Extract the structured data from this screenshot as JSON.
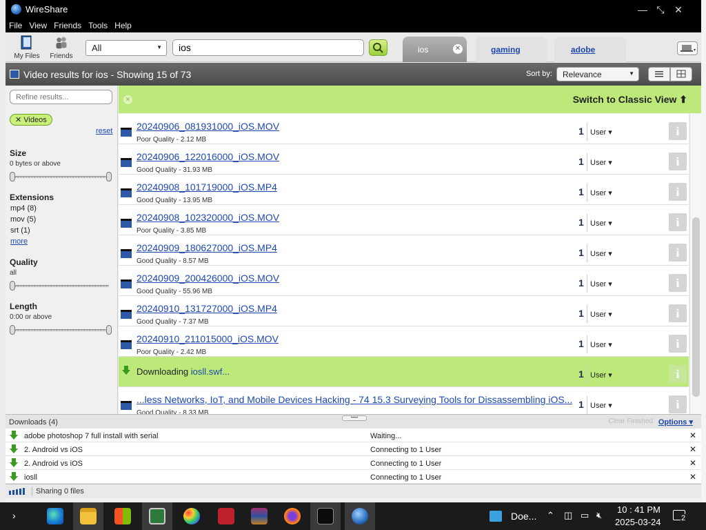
{
  "window": {
    "title": "WireShare"
  },
  "menu": [
    "File",
    "View",
    "Friends",
    "Tools",
    "Help"
  ],
  "toolbar": {
    "my_files": "My Files",
    "friends": "Friends",
    "type_select": "All",
    "search_value": "ios"
  },
  "tabs": [
    {
      "label": "ios",
      "active": true
    },
    {
      "label": "gaming",
      "active": false
    },
    {
      "label": "adobe",
      "active": false
    }
  ],
  "results_header": {
    "title": "Video results for ios - Showing 15 of 73",
    "sort_label": "Sort by:",
    "sort_value": "Relevance"
  },
  "filters": {
    "refine_placeholder": "Refine results...",
    "active_filter": "Videos",
    "reset": "reset",
    "size": {
      "title": "Size",
      "value": "0 bytes or above"
    },
    "extensions": {
      "title": "Extensions",
      "items": [
        "mp4 (8)",
        "mov (5)",
        "srt (1)"
      ],
      "more": "more"
    },
    "quality": {
      "title": "Quality",
      "value": "all"
    },
    "length": {
      "title": "Length",
      "value": "0:00 or above"
    }
  },
  "switch_view": "Switch to Classic View",
  "results": [
    {
      "name": "20240906_081931000_iOS.MOV",
      "sub": "Poor Quality - 2.12 MB",
      "count": "1",
      "user": "User"
    },
    {
      "name": "20240906_122016000_iOS.MOV",
      "sub": "Good Quality - 31.93 MB",
      "count": "1",
      "user": "User"
    },
    {
      "name": "20240908_101719000_iOS.MP4",
      "sub": "Good Quality - 13.95 MB",
      "count": "1",
      "user": "User"
    },
    {
      "name": "20240908_102320000_iOS.MOV",
      "sub": "Poor Quality - 3.85 MB",
      "count": "1",
      "user": "User"
    },
    {
      "name": "20240909_180627000_iOS.MP4",
      "sub": "Good Quality - 8.57 MB",
      "count": "1",
      "user": "User"
    },
    {
      "name": "20240909_200426000_iOS.MOV",
      "sub": "Good Quality - 55.96 MB",
      "count": "1",
      "user": "User"
    },
    {
      "name": "20240910_131727000_iOS.MP4",
      "sub": "Good Quality - 7.37 MB",
      "count": "1",
      "user": "User"
    },
    {
      "name": "20240910_211015000_iOS.MOV",
      "sub": "Poor Quality - 2.42 MB",
      "count": "1",
      "user": "User"
    }
  ],
  "downloading_row": {
    "prefix": "Downloading",
    "file": "iosll.swf...",
    "count": "1",
    "user": "User"
  },
  "last_result": {
    "name": "...less Networks, IoT, and Mobile Devices Hacking - 74 15.3 Surveying Tools for Dissassembling iOS...",
    "sub": "Good Quality - 8.33 MB",
    "count": "1",
    "user": "User"
  },
  "downloads": {
    "title": "Downloads (4)",
    "clear": "Clear Finished",
    "options": "Options",
    "items": [
      {
        "name": "adobe photoshop 7 full install with serial",
        "status": "Waiting..."
      },
      {
        "name": "2. Android vs iOS",
        "status": "Connecting to 1 User"
      },
      {
        "name": "2. Android vs iOS",
        "status": "Connecting to 1 User"
      },
      {
        "name": "iosll",
        "status": "Connecting to 1 User"
      }
    ]
  },
  "status": {
    "sharing": "Sharing 0 files"
  },
  "taskbar": {
    "doc_label": "Doe...",
    "time": "10 : 41 PM",
    "date": "2025-03-24",
    "notifications": "2"
  },
  "colors": {
    "accent_green": "#bde87a",
    "link_blue": "#1c48b0",
    "header_grey": "#555555",
    "taskbar": "#1b1b1b"
  }
}
